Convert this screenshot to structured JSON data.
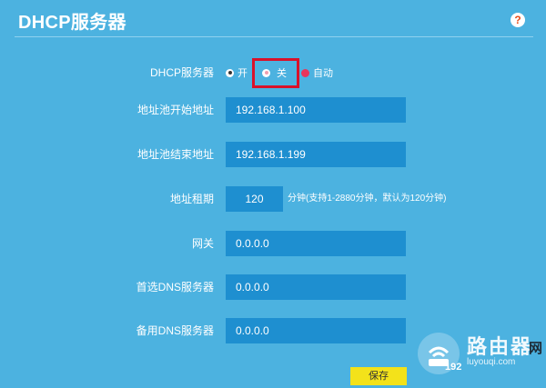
{
  "header": {
    "title": "DHCP服务器",
    "help_glyph": "?"
  },
  "form": {
    "dhcp_server": {
      "label": "DHCP服务器",
      "options": [
        "开",
        "关",
        "自动"
      ],
      "selected": "开"
    },
    "pool_start": {
      "label": "地址池开始地址",
      "value": "192.168.1.100"
    },
    "pool_end": {
      "label": "地址池结束地址",
      "value": "192.168.1.199"
    },
    "lease_time": {
      "label": "地址租期",
      "value": "120",
      "hint": "分钟(支持1-2880分钟，默认为120分钟)"
    },
    "gateway": {
      "label": "网关",
      "value": "0.0.0.0"
    },
    "primary_dns": {
      "label": "首选DNS服务器",
      "value": "0.0.0.0"
    },
    "secondary_dns": {
      "label": "备用DNS服务器",
      "value": "0.0.0.0"
    }
  },
  "footer": {
    "save_label": "保存",
    "ip_fragment": "192"
  },
  "watermark": {
    "brand_cn": "路由器",
    "brand_net": "网",
    "url": "luyouqi.com"
  },
  "colors": {
    "background": "#4cb2e0",
    "field": "#1e8fd0",
    "save_button": "#f3e21a",
    "highlight_box": "#d9112a",
    "help_icon": "#e84e1b"
  }
}
